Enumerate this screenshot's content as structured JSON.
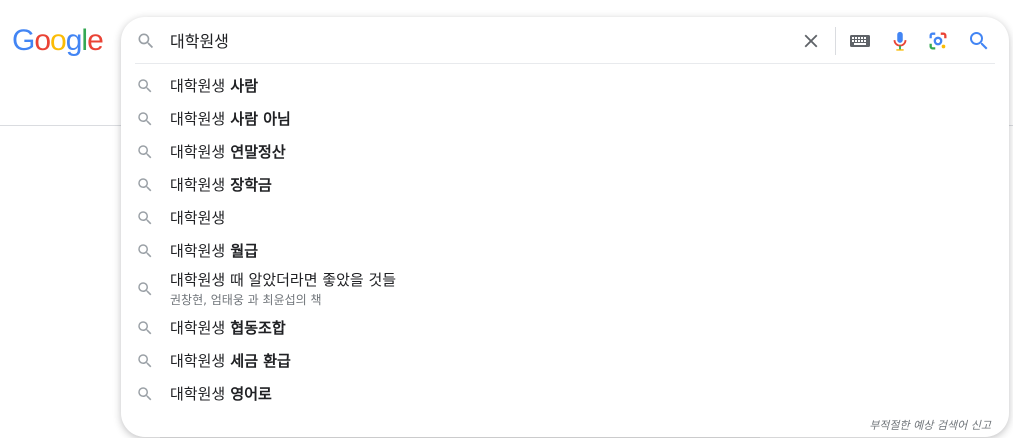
{
  "logo": {
    "letters": [
      "G",
      "o",
      "o",
      "g",
      "l",
      "e"
    ]
  },
  "search": {
    "value": "대학원생"
  },
  "suggestions": [
    {
      "prefix": "대학원생",
      "rest": " 사람",
      "sub": ""
    },
    {
      "prefix": "대학원생",
      "rest": " 사람 아님",
      "sub": ""
    },
    {
      "prefix": "대학원생",
      "rest": " 연말정산",
      "sub": ""
    },
    {
      "prefix": "대학원생",
      "rest": " 장학금",
      "sub": ""
    },
    {
      "prefix": "대학원생",
      "rest": "",
      "sub": ""
    },
    {
      "prefix": "대학원생",
      "rest": " 월급",
      "sub": ""
    },
    {
      "prefix": "대학원생 때 알았더라면 좋았을 것들",
      "rest": "",
      "sub": "권창현, 엄태웅 과 최윤섭의 책"
    },
    {
      "prefix": "대학원생",
      "rest": " 협동조합",
      "sub": ""
    },
    {
      "prefix": "대학원생",
      "rest": " 세금 환급",
      "sub": ""
    },
    {
      "prefix": "대학원생",
      "rest": " 영어로",
      "sub": ""
    }
  ],
  "footer": {
    "report_label": "부적절한 예상 검색어 신고"
  },
  "colors": {
    "blue": "#4285f4",
    "red": "#ea4335",
    "yellow": "#fbbc05",
    "green": "#34a853",
    "icon_gray": "#9aa0a6"
  },
  "icons": [
    "search-icon",
    "close-icon",
    "keyboard-icon",
    "mic-icon",
    "lens-icon"
  ]
}
